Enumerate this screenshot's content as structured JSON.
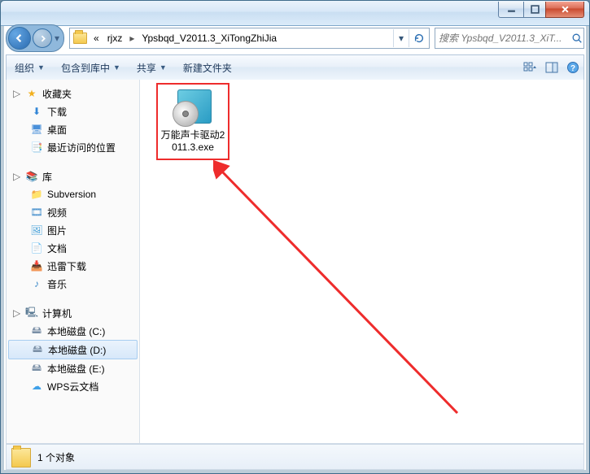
{
  "breadcrumb": {
    "seg1": "rjxz",
    "seg2": "Ypsbqd_V2011.3_XiTongZhiJia",
    "prefix": "«"
  },
  "search": {
    "placeholder": "搜索 Ypsbqd_V2011.3_XiT..."
  },
  "toolbar": {
    "organize": "组织",
    "include": "包含到库中",
    "share": "共享",
    "newfolder": "新建文件夹"
  },
  "sidebar": {
    "favorites": {
      "label": "收藏夹",
      "items": [
        "下载",
        "桌面",
        "最近访问的位置"
      ]
    },
    "libraries": {
      "label": "库",
      "items": [
        "Subversion",
        "视频",
        "图片",
        "文档",
        "迅雷下载",
        "音乐"
      ]
    },
    "computer": {
      "label": "计算机",
      "items": [
        "本地磁盘 (C:)",
        "本地磁盘 (D:)",
        "本地磁盘 (E:)",
        "WPS云文档"
      ],
      "selectedIndex": 1
    }
  },
  "file": {
    "name": "万能声卡驱动2011.3.exe"
  },
  "status": {
    "text": "1 个对象"
  }
}
